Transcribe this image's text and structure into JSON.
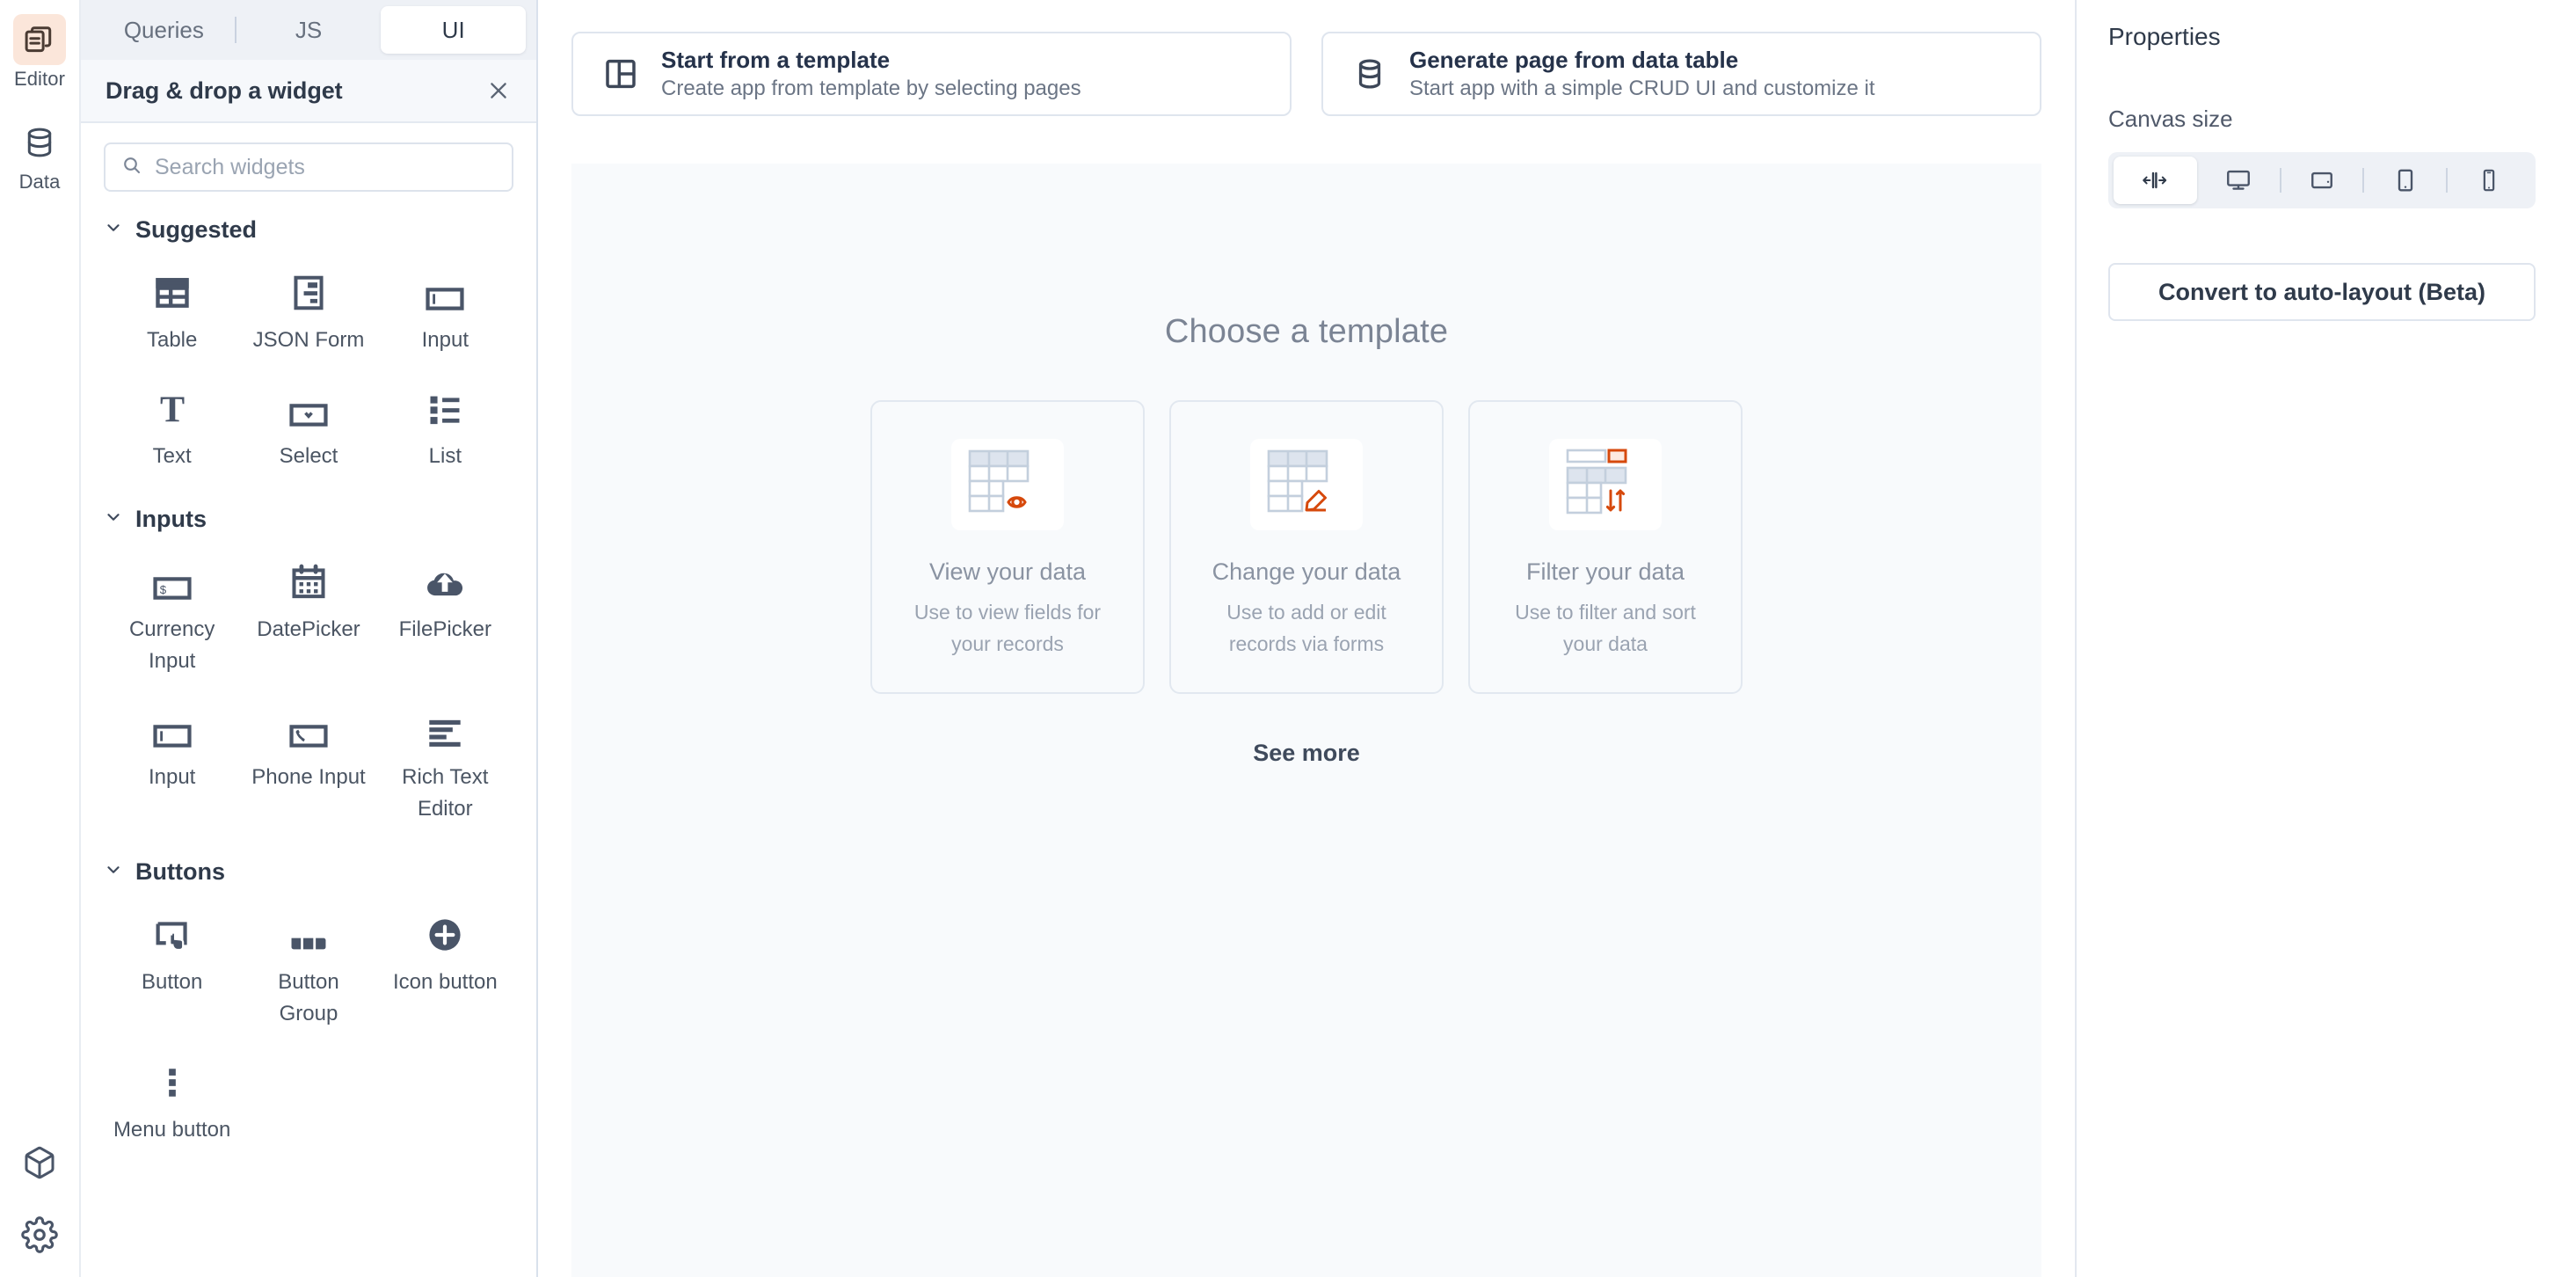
{
  "rail": {
    "items": [
      {
        "label": "Editor",
        "icon": "editor-pages-icon",
        "active": true
      },
      {
        "label": "Data",
        "icon": "database-icon",
        "active": false
      }
    ],
    "bottom": [
      {
        "icon": "cube-icon"
      },
      {
        "icon": "gear-icon"
      }
    ]
  },
  "widget_panel": {
    "tabs": [
      {
        "label": "Queries",
        "active": false
      },
      {
        "label": "JS",
        "active": false
      },
      {
        "label": "UI",
        "active": true
      }
    ],
    "header": {
      "title": "Drag & drop a widget",
      "close_icon": "close-icon"
    },
    "search": {
      "placeholder": "Search widgets",
      "value": "",
      "icon": "search-icon"
    },
    "groups": [
      {
        "title": "Suggested",
        "collapsed": false,
        "widgets": [
          {
            "label": "Table",
            "icon": "table-icon"
          },
          {
            "label": "JSON Form",
            "icon": "json-form-icon"
          },
          {
            "label": "Input",
            "icon": "input-icon"
          },
          {
            "label": "Text",
            "icon": "text-icon"
          },
          {
            "label": "Select",
            "icon": "select-icon"
          },
          {
            "label": "List",
            "icon": "list-icon"
          }
        ]
      },
      {
        "title": "Inputs",
        "collapsed": false,
        "widgets": [
          {
            "label": "Currency Input",
            "icon": "currency-input-icon"
          },
          {
            "label": "DatePicker",
            "icon": "calendar-icon"
          },
          {
            "label": "FilePicker",
            "icon": "cloud-upload-icon"
          },
          {
            "label": "Input",
            "icon": "input-icon"
          },
          {
            "label": "Phone Input",
            "icon": "phone-input-icon"
          },
          {
            "label": "Rich Text Editor",
            "icon": "rich-text-icon"
          }
        ]
      },
      {
        "title": "Buttons",
        "collapsed": false,
        "widgets": [
          {
            "label": "Button",
            "icon": "button-click-icon"
          },
          {
            "label": "Button Group",
            "icon": "button-group-icon"
          },
          {
            "label": "Icon button",
            "icon": "plus-circle-icon"
          },
          {
            "label": "Menu button",
            "icon": "vertical-dots-icon"
          }
        ]
      }
    ]
  },
  "main": {
    "top_cards": [
      {
        "title": "Start from a template",
        "subtitle": "Create app from template by selecting pages",
        "icon": "template-layout-icon"
      },
      {
        "title": "Generate page from data table",
        "subtitle": "Start app with a simple CRUD UI and customize it",
        "icon": "database-icon"
      }
    ],
    "canvas": {
      "heading": "Choose a template",
      "templates": [
        {
          "name": "View your data",
          "description": "Use to view fields for your records",
          "icon": "table-eye-icon"
        },
        {
          "name": "Change your data",
          "description": "Use to add or edit records via forms",
          "icon": "table-pencil-icon"
        },
        {
          "name": "Filter your data",
          "description": "Use to filter and sort your data",
          "icon": "table-sort-icon"
        }
      ],
      "see_more": "See more"
    }
  },
  "properties": {
    "title": "Properties",
    "canvas_size_label": "Canvas size",
    "canvas_sizes": [
      {
        "name": "fluid",
        "icon": "fluid-width-icon",
        "active": true
      },
      {
        "name": "desktop",
        "icon": "desktop-icon",
        "active": false
      },
      {
        "name": "tablet-landscape",
        "icon": "tablet-landscape-icon",
        "active": false
      },
      {
        "name": "tablet",
        "icon": "tablet-icon",
        "active": false
      },
      {
        "name": "mobile",
        "icon": "mobile-icon",
        "active": false
      }
    ],
    "convert_button": "Convert to auto-layout (Beta)"
  },
  "colors": {
    "accent": "#d6490c",
    "active_rail_bg": "#fbe6da",
    "canvas_bg": "#f8fafc",
    "tabbar_bg": "#eef1f6",
    "icon": "#4a5568"
  }
}
